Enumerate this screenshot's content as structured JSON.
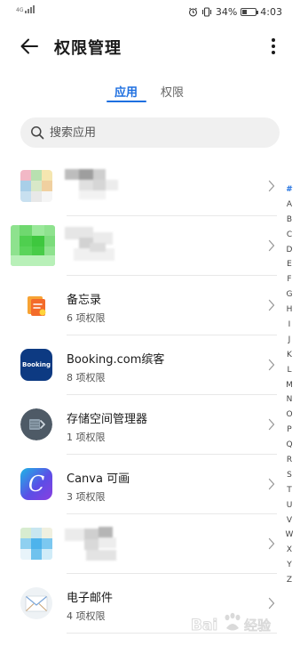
{
  "status_bar": {
    "network": "4G",
    "battery_percent": "34%",
    "battery_level": 0.34,
    "time": "4:03"
  },
  "header": {
    "title": "权限管理"
  },
  "tabs": [
    {
      "label": "应用",
      "active": true
    },
    {
      "label": "权限",
      "active": false
    }
  ],
  "search": {
    "placeholder": "搜索应用",
    "value": ""
  },
  "apps": [
    {
      "name": "",
      "permissions": "",
      "icon": "blurred-app-icon",
      "blurred": true
    },
    {
      "name": "",
      "permissions": "",
      "icon": "blurred-app-icon",
      "blurred": true
    },
    {
      "name": "备忘录",
      "permissions": "6 项权限",
      "icon": "memo-icon",
      "blurred": false
    },
    {
      "name": "Booking.com缤客",
      "permissions": "8 项权限",
      "icon": "booking-icon",
      "icon_text": "Booking",
      "blurred": false
    },
    {
      "name": "存储空间管理器",
      "permissions": "1 项权限",
      "icon": "storage-manager-icon",
      "blurred": false
    },
    {
      "name": "Canva 可画",
      "permissions": "3 项权限",
      "icon": "canva-icon",
      "icon_text": "C",
      "blurred": false
    },
    {
      "name": "",
      "permissions": "",
      "icon": "blurred-app-icon",
      "blurred": true
    },
    {
      "name": "电子邮件",
      "permissions": "4 项权限",
      "icon": "email-icon",
      "blurred": false
    }
  ],
  "alpha_index": [
    "#",
    "A",
    "B",
    "C",
    "D",
    "E",
    "F",
    "G",
    "H",
    "I",
    "J",
    "K",
    "L",
    "M",
    "N",
    "O",
    "P",
    "Q",
    "R",
    "S",
    "T",
    "U",
    "V",
    "W",
    "X",
    "Y",
    "Z"
  ],
  "colors": {
    "accent": "#1e6fe0",
    "search_bg": "#f0f0f0",
    "divider": "#e8e8e8"
  }
}
